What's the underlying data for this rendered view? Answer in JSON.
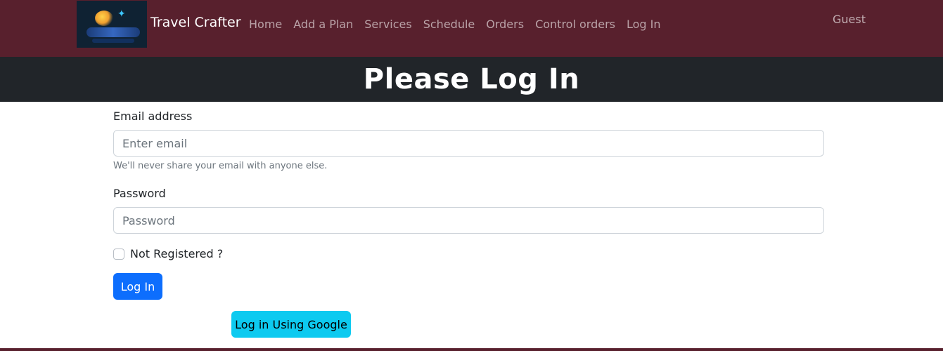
{
  "navbar": {
    "brand": "Travel Crafter",
    "links": [
      "Home",
      "Add a Plan",
      "Services",
      "Schedule",
      "Orders",
      "Control orders",
      "Log In"
    ],
    "user": "Guest",
    "background": "#58202d"
  },
  "hero": {
    "title": "Please Log In"
  },
  "form": {
    "email_label": "Email address",
    "email_placeholder": "Enter email",
    "email_help": "We'll never share your email with anyone else.",
    "password_label": "Password",
    "password_placeholder": "Password",
    "checkbox_label": "Not Registered ?",
    "login_button": "Log In",
    "google_button": "Log in Using Google"
  },
  "colors": {
    "primary": "#0d6efd",
    "info": "#0dcaf0",
    "hero_bg": "#212529"
  }
}
